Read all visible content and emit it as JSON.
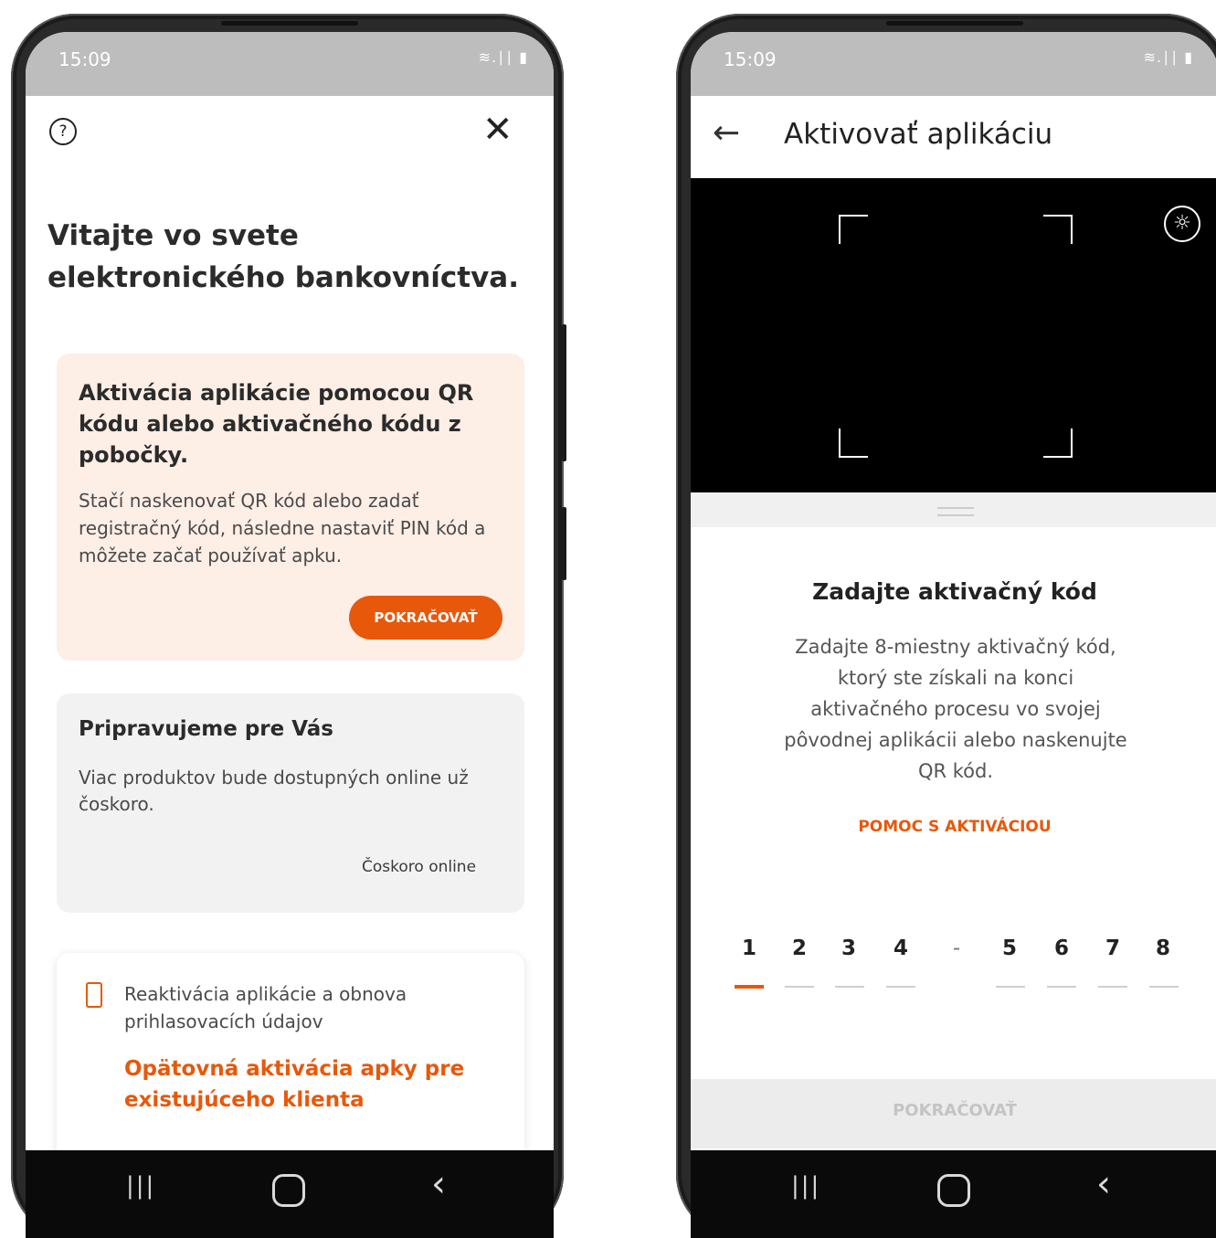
{
  "left": {
    "status": {
      "time": "15:09",
      "icons": "≋.∣∣ ▮"
    },
    "header": {
      "help_icon": "?",
      "close_icon": "✕"
    },
    "title": "Vitajte vo svete elektronického bankovníctva.",
    "activate_card": {
      "title": "Aktivácia aplikácie pomocou QR kódu alebo aktivačného kódu z pobočky.",
      "text": "Stačí naskenovať QR kód alebo zadať registračný kód, následne nastaviť PIN kód a môžete začať používať apku.",
      "button": "POKRAČOVAŤ"
    },
    "soon_card": {
      "title": "Pripravujeme pre Vás",
      "text": "Viac produktov bude dostupných online už čoskoro.",
      "link": "Čoskoro online"
    },
    "reactivate_card": {
      "text": "Reaktivácia aplikácie a obnova prihlasovacích údajov",
      "link": "Opätovná aktivácia apky pre existujúceho klienta"
    },
    "navbar": {
      "recent": "|||",
      "back": "‹"
    }
  },
  "right": {
    "status": {
      "time": "15:09",
      "icons": "≋.∣∣ ▮"
    },
    "header": {
      "back_icon": "←",
      "title": "Aktivovať aplikáciu"
    },
    "flash_icon": "☼",
    "subtitle": "Zadajte aktivačný kód",
    "description": "Zadajte 8-miestny aktivačný kód, ktorý ste získali na konci aktivačného procesu vo svojej pôvodnej aplikácii alebo naskenujte QR kód.",
    "help_link": "POMOC S AKTIVÁCIOU",
    "code_digits": [
      "1",
      "2",
      "3",
      "4",
      "5",
      "6",
      "7",
      "8"
    ],
    "separator": "-",
    "continue_button": "POKRAČOVAŤ",
    "navbar": {
      "recent": "|||",
      "back": "‹"
    }
  },
  "colors": {
    "accent": "#e8580b",
    "card_peach": "#fdeee6",
    "card_gray": "#f2f2f2"
  }
}
